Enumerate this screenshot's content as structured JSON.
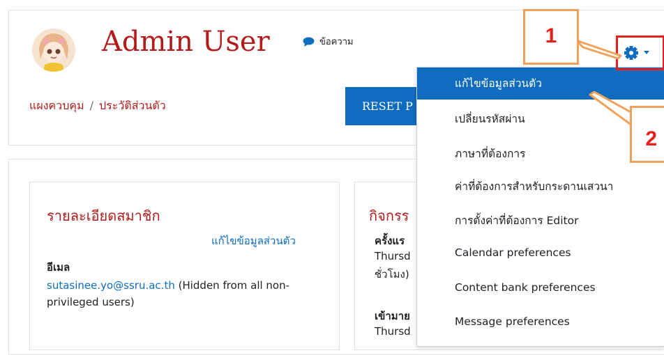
{
  "profile": {
    "user_name": "Admin User",
    "message_label": "ข้อความ",
    "avatar_icon": "cartoon-avatar-icon",
    "message_icon": "speech-bubble-icon"
  },
  "breadcrumb": {
    "items": [
      "แผงควบคุม",
      "ประวัติส่วนตัว"
    ],
    "separator": "/"
  },
  "reset_button": {
    "label": "RESET P"
  },
  "user_details": {
    "title": "รายละเอียดสมาชิก",
    "edit_link": "แก้ไขข้อมูลส่วนตัว",
    "email_label": "อีเมล",
    "email_value": "sutasinee.yo@ssru.ac.th",
    "email_note": " (Hidden from all non-privileged users)"
  },
  "activity": {
    "title": "กิจกรร",
    "first_access_label": "ครั้งแร",
    "first_access_value": "Thursd",
    "first_access_extra": "ชั่วโมง)",
    "last_access_label": "เข้ามาย",
    "last_access_value": "Thursd"
  },
  "gear_menu": {
    "icon": "gear-icon",
    "caret_icon": "caret-down-icon",
    "items": [
      "แก้ไขข้อมูลส่วนตัว",
      "เปลี่ยนรหัสผ่าน",
      "ภาษาที่ต้องการ",
      "ค่าที่ต้องการสำหรับกระดานเสวนา",
      "การตั้งค่าที่ต้องการ Editor",
      "Calendar preferences",
      "Content bank preferences",
      "Message preferences"
    ]
  },
  "annotations": {
    "callout_1": "1",
    "callout_2": "2"
  },
  "colors": {
    "brand_red": "#b31b1b",
    "link_blue": "#0f6cbf",
    "highlight_red": "#e8201c",
    "callout_orange": "#f0a25a"
  }
}
